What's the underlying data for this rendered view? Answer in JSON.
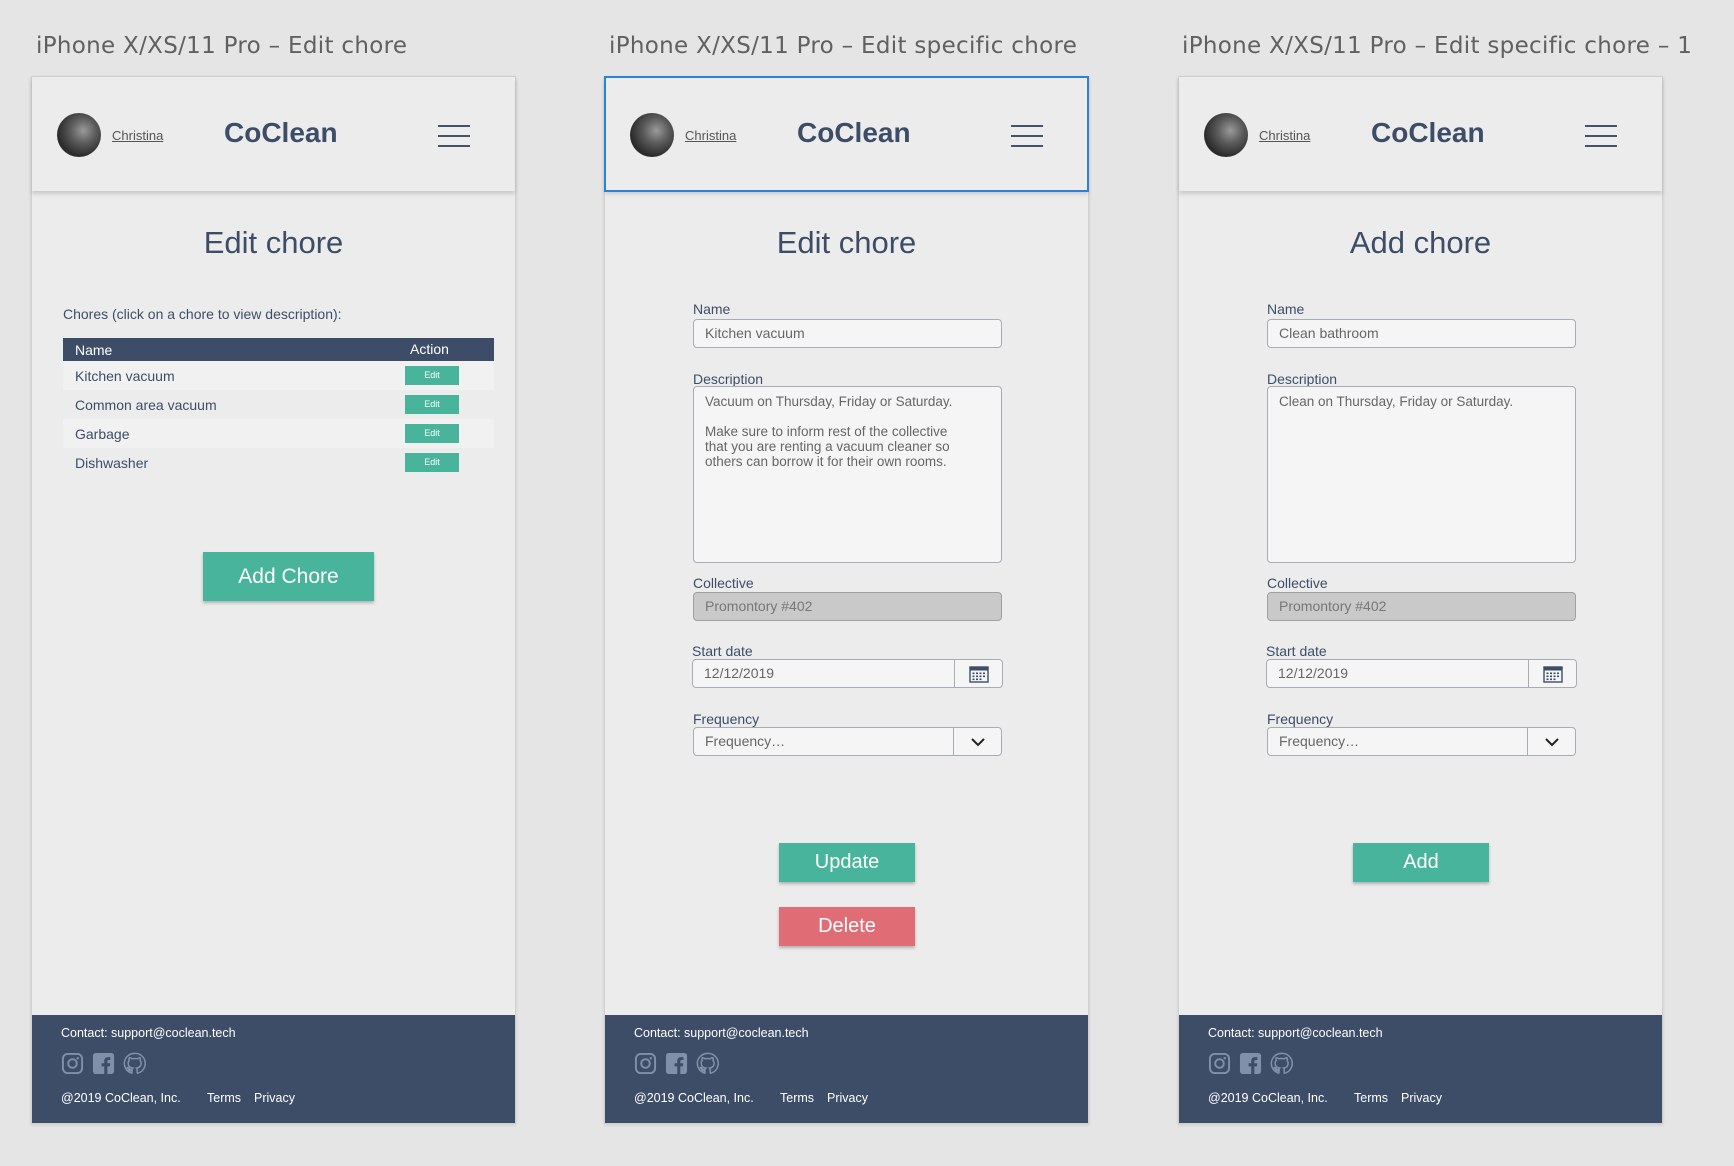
{
  "artboards": [
    {
      "title": "iPhone X/XS/11 Pro – Edit chore"
    },
    {
      "title": "iPhone X/XS/11 Pro – Edit specific chore"
    },
    {
      "title": "iPhone X/XS/11 Pro – Edit specific chore – 1"
    }
  ],
  "header": {
    "user_name": "Christina",
    "brand": "CoClean"
  },
  "screen1": {
    "page_title": "Edit chore",
    "caption": "Chores (click on a chore to view description):",
    "table_headers": {
      "name": "Name",
      "action": "Action"
    },
    "chores": [
      {
        "name": "Kitchen vacuum",
        "action": "Edit"
      },
      {
        "name": "Common area vacuum",
        "action": "Edit"
      },
      {
        "name": "Garbage",
        "action": "Edit"
      },
      {
        "name": "Dishwasher",
        "action": "Edit"
      }
    ],
    "add_button": "Add Chore"
  },
  "screen2": {
    "page_title": "Edit chore",
    "name_label": "Name",
    "name_value": "Kitchen vacuum",
    "description_label": "Description",
    "description_value": "Vacuum on Thursday, Friday or Saturday.\n\nMake sure to inform rest of the collective that you are renting a vacuum cleaner so others can borrow it for their own rooms.",
    "collective_label": "Collective",
    "collective_value": "Promontory #402",
    "start_date_label": "Start date",
    "start_date_value": "12/12/2019",
    "frequency_label": "Frequency",
    "frequency_placeholder": "Frequency…",
    "update_button": "Update",
    "delete_button": "Delete"
  },
  "screen3": {
    "page_title": "Add chore",
    "name_label": "Name",
    "name_value": "Clean bathroom",
    "description_label": "Description",
    "description_value": "Clean on Thursday, Friday or Saturday.",
    "collective_label": "Collective",
    "collective_value": "Promontory #402",
    "start_date_label": "Start date",
    "start_date_value": "12/12/2019",
    "frequency_label": "Frequency",
    "frequency_placeholder": "Frequency…",
    "add_button": "Add"
  },
  "footer": {
    "contact": "Contact: support@coclean.tech",
    "copyright": "@2019 CoClean, Inc.",
    "terms": "Terms",
    "privacy": "Privacy",
    "social_icons": [
      "instagram-icon",
      "facebook-icon",
      "github-icon"
    ]
  },
  "colors": {
    "navy": "#3d4d68",
    "green": "#47b49b",
    "red": "#e06c75",
    "selection": "#2c82d8"
  }
}
